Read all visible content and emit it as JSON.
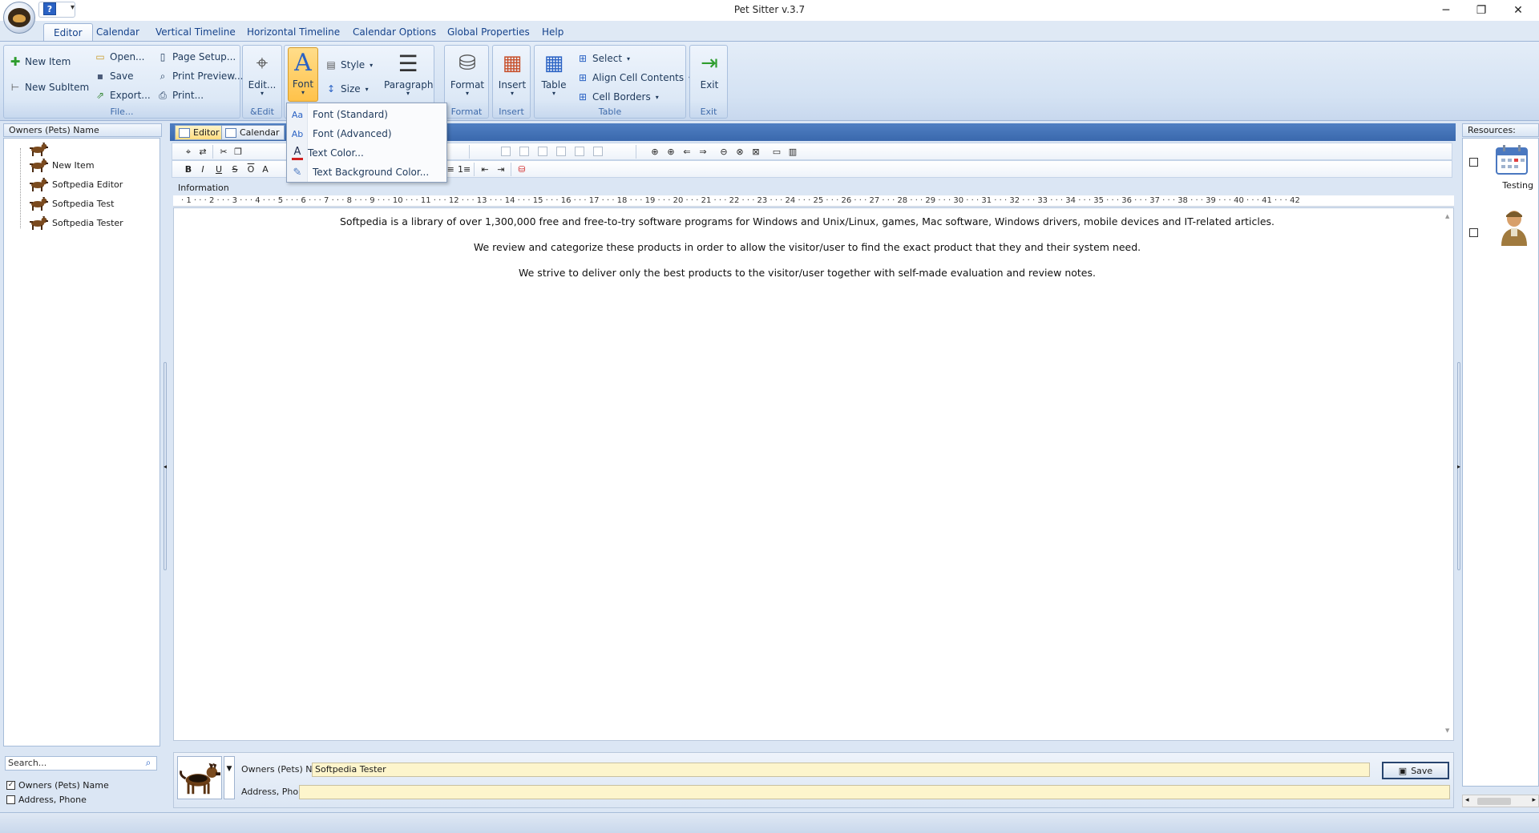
{
  "window": {
    "title": "Pet Sitter v.3.7",
    "help_glyph": "?",
    "qat_more_glyph": "▾",
    "minimize_glyph": "─",
    "restore_glyph": "❐",
    "close_glyph": "✕"
  },
  "tabs": [
    "Editor",
    "Calendar",
    "Vertical Timeline",
    "Horizontal Timeline",
    "Calendar Options",
    "Global Properties",
    "Help"
  ],
  "ribbon": {
    "file": {
      "label": "File...",
      "new_item": "New Item",
      "new_subitem": "New SubItem",
      "open": "Open...",
      "save": "Save",
      "export": "Export...",
      "page_setup": "Page Setup...",
      "print_preview": "Print Preview...",
      "print": "Print..."
    },
    "edit": {
      "label": "&Edit",
      "edit_btn": "Edit..."
    },
    "font_btn": "Font",
    "style_btn": "Style",
    "size_btn": "Size",
    "paragraph_btn": "Paragraph",
    "format": {
      "label": "Format",
      "btn": "Format"
    },
    "insert": {
      "label": "Insert",
      "btn": "Insert"
    },
    "table": {
      "label": "Table",
      "btn": "Table",
      "select": "Select",
      "align": "Align Cell Contents",
      "borders": "Cell Borders"
    },
    "exit": {
      "label": "Exit",
      "btn": "Exit"
    }
  },
  "font_menu": {
    "items": [
      "Font (Standard)",
      "Font (Advanced)",
      "Text Color...",
      "Text Background Color..."
    ]
  },
  "left_panel": {
    "header": "Owners (Pets) Name",
    "tree": [
      "",
      "New Item",
      "Softpedia Editor",
      "Softpedia Test",
      "Softpedia Tester"
    ],
    "search_placeholder": "Search...",
    "checks": [
      {
        "label": "Owners (Pets) Name",
        "checked": true
      },
      {
        "label": "Address, Phone",
        "checked": false
      }
    ]
  },
  "doc_tabs": [
    "Editor",
    "Calendar"
  ],
  "editor": {
    "info_label": "Information",
    "paragraphs": [
      "Softpedia is a library of over 1,300,000 free and free-to-try software programs for Windows and Unix/Linux, games, Mac software, Windows drivers, mobile devices and IT-related articles.",
      "We review and categorize these products in order to allow the visitor/user to find the exact product that they and their system need.",
      "We strive to deliver only the best products to the visitor/user together with self-made evaluation and review notes."
    ],
    "ruler_text": "· 1 · · · 2 · · · 3 · · · 4 · · · 5 · · · 6 · · · 7 · · · 8 · · · 9 · · · 10 · · · 11 · · · 12 · · · 13 · · · 14 · · · 15 · · · 16 · · · 17 · · · 18 · · · 19 · · · 20 · · · 21 · · · 22 · · · 23 · · · 24 · · · 25 · · · 26 · · · 27 · · · 28 · · · 29 · · · 30 · · · 31 · · · 32 · · · 33 · · · 34 · · · 35 · · · 36 · · · 37 · · · 38 · · · 39 · · · 40 · · · 41 · · · 42"
  },
  "form": {
    "name_label": "Owners (Pets) Name:",
    "name_value": "Softpedia Tester",
    "address_label": "Address, Phone:",
    "address_value": "",
    "save_label": "Save"
  },
  "right_panel": {
    "header": "Resources:",
    "items": [
      {
        "label": "Testing"
      },
      {
        "label": ""
      }
    ]
  }
}
